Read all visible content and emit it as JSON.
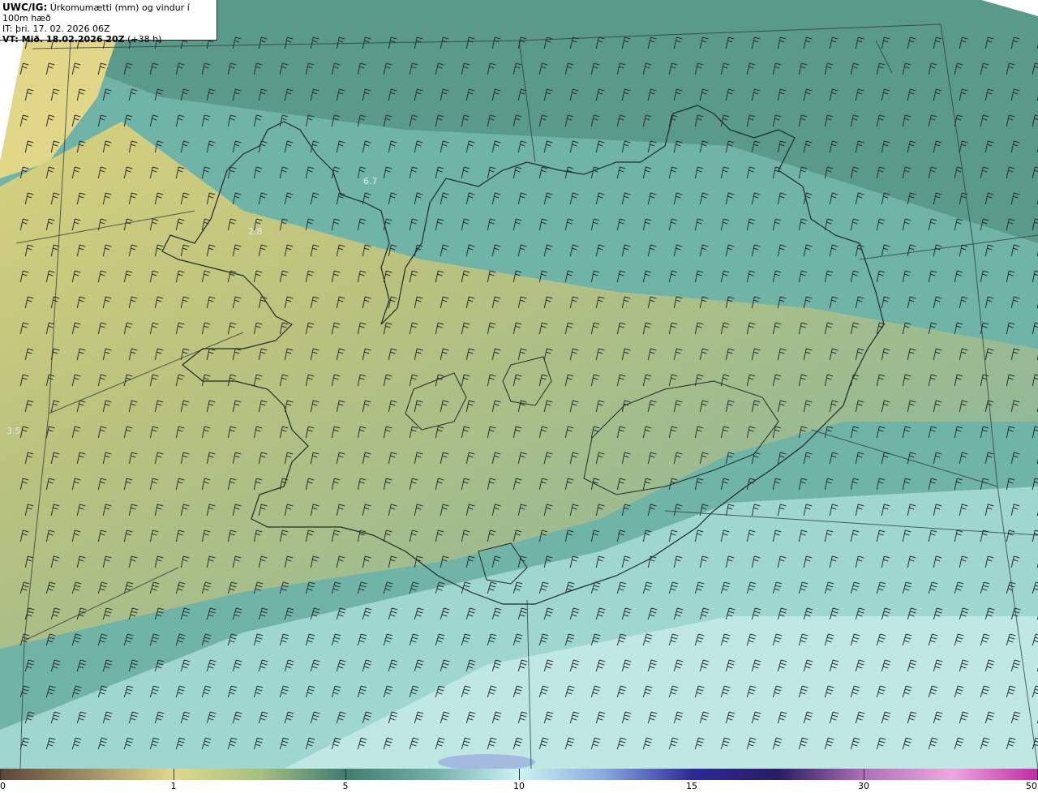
{
  "header": {
    "title_bold": "UWC/IG:",
    "title_rest": " Úrkomumætti (mm) og vindur í 100m hæð",
    "issue_time": "IT: þri. 17. 02. 2026 06Z",
    "valid_bold": "VT: Mið. 18.02.2026 20Z",
    "valid_rest": " (+38 h)"
  },
  "legend": {
    "ticks": [
      {
        "value": "0",
        "frac": 0.0
      },
      {
        "value": "1",
        "frac": 0.167
      },
      {
        "value": "5",
        "frac": 0.333
      },
      {
        "value": "10",
        "frac": 0.5
      },
      {
        "value": "15",
        "frac": 0.667
      },
      {
        "value": "30",
        "frac": 0.833
      },
      {
        "value": "50",
        "frac": 1.0
      }
    ],
    "colors": [
      "#5b4636",
      "#a08c64",
      "#e0d98a",
      "#a7c07e",
      "#3f7d6e",
      "#6fb0a8",
      "#cdf3f3",
      "#8aa6e0",
      "#2a2a9a",
      "#2b1b66",
      "#b06fb8",
      "#f0a6e0",
      "#c02aa6"
    ]
  },
  "map_labels": [
    {
      "text": "6.7"
    },
    {
      "text": "2.8"
    },
    {
      "text": "3.5"
    }
  ]
}
